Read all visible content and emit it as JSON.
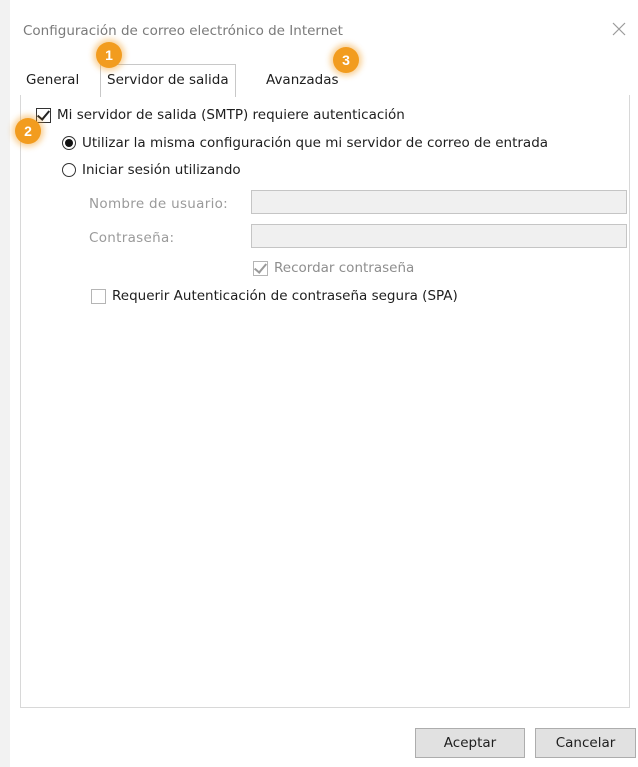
{
  "window": {
    "title": "Configuración de correo electrónico de Internet",
    "close_icon": "close-icon"
  },
  "tabs": [
    {
      "label": "General",
      "active": false
    },
    {
      "label": "Servidor de salida",
      "active": true
    },
    {
      "label": "Avanzadas",
      "active": false
    }
  ],
  "outgoing": {
    "smtp_auth": {
      "label": "Mi servidor de salida (SMTP) requiere autenticación",
      "checked": true
    },
    "same_settings": {
      "label": "Utilizar la misma configuración que mi servidor de correo de entrada",
      "selected": true
    },
    "login_using": {
      "label": "Iniciar sesión utilizando",
      "selected": false
    },
    "username": {
      "label": "Nombre de usuario:",
      "value": ""
    },
    "password": {
      "label": "Contraseña:",
      "value": ""
    },
    "remember_password": {
      "label": "Recordar contraseña",
      "checked": true,
      "enabled": false
    },
    "spa": {
      "label": "Requerir Autenticación de contraseña segura (SPA)",
      "checked": false,
      "enabled": false
    }
  },
  "buttons": {
    "ok": "Aceptar",
    "cancel": "Cancelar"
  },
  "annotations": [
    "1",
    "2",
    "3"
  ],
  "colors": {
    "badge": "#f29c1f",
    "button_face": "#e1e1e1",
    "disabled_field": "#f0f0f0"
  }
}
